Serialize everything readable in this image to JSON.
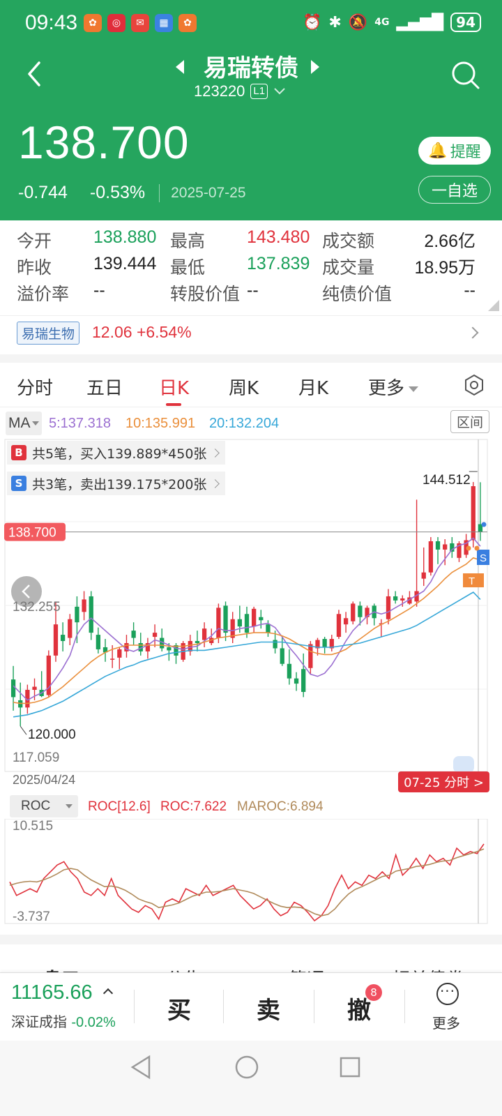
{
  "status_bar": {
    "time": "09:43",
    "network": "4G",
    "battery": "94"
  },
  "header": {
    "title": "易瑞转债",
    "code": "123220",
    "level_badge": "L1",
    "price": "138.700",
    "change": "-0.744",
    "change_pct": "-0.53%",
    "date": "2025-07-25",
    "remind_label": "提醒",
    "watchlist_label": "一自选"
  },
  "quote": {
    "open_label": "今开",
    "open": "138.880",
    "high_label": "最高",
    "high": "143.480",
    "amount_label": "成交额",
    "amount": "2.66亿",
    "prev_close_label": "昨收",
    "prev_close": "139.444",
    "low_label": "最低",
    "low": "137.839",
    "volume_label": "成交量",
    "volume": "18.95万",
    "premium_label": "溢价率",
    "premium": "--",
    "conversion_label": "转股价值",
    "conversion": "--",
    "bond_value_label": "纯债价值",
    "bond_value": "--"
  },
  "underlying": {
    "name": "易瑞生物",
    "price_change": "12.06 +6.54%"
  },
  "tabs": [
    "分时",
    "五日",
    "日K",
    "周K",
    "月K",
    "更多"
  ],
  "active_tab": "日K",
  "ma": {
    "selector": "MA",
    "ma5": "5:137.318",
    "ma10": "10:135.991",
    "ma20": "20:132.204",
    "range_label": "区间",
    "colors": {
      "ma5": "#9b6fd1",
      "ma10": "#ea8f3b",
      "ma20": "#36a7d8"
    }
  },
  "trades": {
    "buy_badge": "B",
    "buy_text": "共5笔，买入139.889*450张",
    "sell_badge": "S",
    "sell_text": "共3笔，卖出139.175*200张"
  },
  "kline_labels": {
    "current_price": "138.700",
    "max_label": "144.512",
    "min_label": "120.000",
    "axis_mid": "132.255",
    "axis_low": "117.059",
    "start_date": "2025/04/24",
    "intraday_link": "07-25 分时 >",
    "t_marker": "T",
    "s_marker": "S"
  },
  "roc": {
    "selector": "ROC",
    "params": "ROC[12.6]",
    "roc_value": "ROC:7.622",
    "maroc_value": "MAROC:6.894",
    "axis_high": "10.515",
    "axis_low": "-3.737",
    "colors": {
      "roc": "#e0323c",
      "maroc": "#b08a5a"
    }
  },
  "bottom_tabs": [
    "盘口",
    "公告",
    "简况",
    "相关债券"
  ],
  "action_bar": {
    "index_value": "11165.66",
    "index_name": "深证成指",
    "index_change": "-0.02%",
    "buy": "买",
    "sell": "卖",
    "cancel": "撤",
    "cancel_badge": "8",
    "more": "更多"
  },
  "theme": {
    "header_bg": "#25a55e",
    "up": "#e0323c",
    "down": "#1aa05a"
  },
  "chart_data": [
    {
      "type": "candlestick",
      "title": "日K",
      "x_start": "2025/04/24",
      "x_end": "2025-07-25",
      "ylim": [
        117.059,
        144.512
      ],
      "candles": [
        [
          124.5,
          125.8,
          121.5,
          122.8
        ],
        [
          122.5,
          124.2,
          120.0,
          121.8
        ],
        [
          121.8,
          124.0,
          121.2,
          123.5
        ],
        [
          123.5,
          124.6,
          122.5,
          123.8
        ],
        [
          123.5,
          125.3,
          122.8,
          122.9
        ],
        [
          123.0,
          127.3,
          122.8,
          126.8
        ],
        [
          126.8,
          132.0,
          126.2,
          129.8
        ],
        [
          128.8,
          130.0,
          127.2,
          128.2
        ],
        [
          128.5,
          130.8,
          127.8,
          130.3
        ],
        [
          131.5,
          132.5,
          128.0,
          130.0
        ],
        [
          131.0,
          133.0,
          130.2,
          132.2
        ],
        [
          132.5,
          133.0,
          128.3,
          129.0
        ],
        [
          128.8,
          129.5,
          127.0,
          127.4
        ],
        [
          127.6,
          128.4,
          126.2,
          127.1
        ],
        [
          126.4,
          127.8,
          125.6,
          126.5
        ],
        [
          126.6,
          127.6,
          125.5,
          127.4
        ],
        [
          127.2,
          128.8,
          126.6,
          128.0
        ],
        [
          129.2,
          130.0,
          127.8,
          128.5
        ],
        [
          128.0,
          129.0,
          126.8,
          127.2
        ],
        [
          127.2,
          128.5,
          126.5,
          128.0
        ],
        [
          128.6,
          129.8,
          127.6,
          129.0
        ],
        [
          128.5,
          129.4,
          127.2,
          127.5
        ],
        [
          127.6,
          128.0,
          126.3,
          127.3
        ],
        [
          127.8,
          128.0,
          126.0,
          126.8
        ],
        [
          126.4,
          128.2,
          126.2,
          128.0
        ],
        [
          127.2,
          128.8,
          126.8,
          128.2
        ],
        [
          128.2,
          129.2,
          127.2,
          128.0
        ],
        [
          128.3,
          130.0,
          127.6,
          129.4
        ],
        [
          128.0,
          129.4,
          127.8,
          128.5
        ],
        [
          128.5,
          131.8,
          128.0,
          131.4
        ],
        [
          131.6,
          132.0,
          128.2,
          129.0
        ],
        [
          128.5,
          131.0,
          128.0,
          130.3
        ],
        [
          130.3,
          131.6,
          129.0,
          129.6
        ],
        [
          130.8,
          131.5,
          128.5,
          129.0
        ],
        [
          129.6,
          131.5,
          129.0,
          131.3
        ],
        [
          130.5,
          131.2,
          129.4,
          130.2
        ],
        [
          129.8,
          130.2,
          128.6,
          129.0
        ],
        [
          128.3,
          129.2,
          127.0,
          127.5
        ],
        [
          127.5,
          128.6,
          125.8,
          126.0
        ],
        [
          126.0,
          127.4,
          124.0,
          124.6
        ],
        [
          124.6,
          125.2,
          123.4,
          124.1
        ],
        [
          125.5,
          127.0,
          122.8,
          123.3
        ],
        [
          125.6,
          128.2,
          125.0,
          127.9
        ],
        [
          127.5,
          128.5,
          126.8,
          128.3
        ],
        [
          128.4,
          128.6,
          127.0,
          127.6
        ],
        [
          127.5,
          128.8,
          127.2,
          128.4
        ],
        [
          128.6,
          131.2,
          128.4,
          130.8
        ],
        [
          129.8,
          131.0,
          129.0,
          130.4
        ],
        [
          130.1,
          132.0,
          129.8,
          131.8
        ],
        [
          131.6,
          132.0,
          129.7,
          130.5
        ],
        [
          130.5,
          131.6,
          129.8,
          131.4
        ],
        [
          131.6,
          131.8,
          129.7,
          130.4
        ],
        [
          129.8,
          130.3,
          128.6,
          129.9
        ],
        [
          130.3,
          133.2,
          129.8,
          132.5
        ],
        [
          132.5,
          133.0,
          131.8,
          132.1
        ],
        [
          132.1,
          132.6,
          131.5,
          132.3
        ],
        [
          131.8,
          133.0,
          131.7,
          132.4
        ],
        [
          132.0,
          141.8,
          131.5,
          133.0
        ],
        [
          134.2,
          137.2,
          133.5,
          134.8
        ],
        [
          134.8,
          138.2,
          134.5,
          137.8
        ],
        [
          137.8,
          138.2,
          135.6,
          137.0
        ],
        [
          137.0,
          138.0,
          135.5,
          137.5
        ],
        [
          137.6,
          138.2,
          136.2,
          136.8
        ],
        [
          136.2,
          137.8,
          135.8,
          137.6
        ],
        [
          136.5,
          138.5,
          136.2,
          137.9
        ],
        [
          137.9,
          143.5,
          137.2,
          143.1
        ],
        [
          139.444,
          143.48,
          137.839,
          138.7
        ]
      ],
      "series": [
        {
          "name": "5",
          "values": [
            123.9,
            123.2,
            122.5,
            122.9,
            123.2,
            123.7,
            124.6,
            125.6,
            126.8,
            128.8,
            129.8,
            130.4,
            129.8,
            129.2,
            128.6,
            128.0,
            127.4,
            127.2,
            127.5,
            127.8,
            128.3,
            128.1,
            127.8,
            127.5,
            127.4,
            127.6,
            127.7,
            128.2,
            128.7,
            129.4,
            129.2,
            129.2,
            129.4,
            129.5,
            129.6,
            129.8,
            129.9,
            129.5,
            128.6,
            127.6,
            126.8,
            125.9,
            125.0,
            124.8,
            125.1,
            125.9,
            127.0,
            128.2,
            129.2,
            129.9,
            130.6,
            131.0,
            130.8,
            131.0,
            131.4,
            131.8,
            132.2,
            132.6,
            133.0,
            133.9,
            135.2,
            136.1,
            137.0,
            137.4,
            137.6,
            138.1,
            137.318
          ]
        },
        {
          "name": "10",
          "values": [
            122.3,
            122.2,
            122.2,
            122.3,
            122.5,
            122.8,
            123.3,
            123.8,
            124.4,
            125.0,
            125.6,
            126.2,
            126.7,
            127.1,
            127.4,
            127.6,
            127.8,
            127.8,
            127.8,
            127.8,
            127.8,
            127.8,
            127.7,
            127.7,
            127.7,
            127.8,
            127.9,
            128.1,
            128.3,
            128.5,
            128.6,
            128.7,
            128.8,
            128.9,
            129.0,
            129.0,
            129.0,
            128.9,
            128.7,
            128.4,
            128.0,
            127.6,
            127.2,
            127.0,
            126.9,
            126.9,
            127.1,
            127.4,
            127.9,
            128.4,
            128.9,
            129.4,
            129.8,
            130.1,
            130.5,
            130.9,
            131.3,
            131.8,
            132.3,
            132.9,
            133.5,
            134.2,
            134.8,
            135.2,
            135.6,
            136.2,
            135.991
          ]
        },
        {
          "name": "20",
          "values": [
            120.9,
            121.0,
            121.1,
            121.3,
            121.5,
            121.8,
            122.1,
            122.4,
            122.8,
            123.2,
            123.6,
            124.0,
            124.4,
            124.8,
            125.1,
            125.4,
            125.7,
            125.9,
            126.2,
            126.4,
            126.6,
            126.8,
            127.0,
            127.1,
            127.2,
            127.3,
            127.3,
            127.3,
            127.4,
            127.5,
            127.6,
            127.7,
            127.8,
            127.9,
            128.0,
            128.1,
            128.1,
            128.1,
            128.1,
            128.0,
            127.9,
            127.8,
            127.7,
            127.6,
            127.6,
            127.6,
            127.7,
            127.8,
            127.9,
            128.0,
            128.2,
            128.4,
            128.6,
            128.8,
            129.0,
            129.2,
            129.4,
            129.7,
            130.1,
            130.5,
            130.9,
            131.3,
            131.7,
            132.1,
            132.5,
            132.9,
            132.204
          ]
        }
      ]
    },
    {
      "type": "line",
      "title": "ROC",
      "ylim": [
        -3.737,
        10.515
      ],
      "series": [
        {
          "name": "ROC",
          "values": [
            2.0,
            0.0,
            0.5,
            1.0,
            0.5,
            2.5,
            3.5,
            4.5,
            5.0,
            3.5,
            2.5,
            0.5,
            0.0,
            1.0,
            0.0,
            2.5,
            0.0,
            -1.0,
            -2.0,
            -2.5,
            -1.5,
            -2.0,
            -3.5,
            -1.0,
            -0.5,
            -1.0,
            1.0,
            0.5,
            0.0,
            1.5,
            0.0,
            0.5,
            1.0,
            1.5,
            0.0,
            -1.0,
            -2.0,
            -1.5,
            -0.5,
            -2.0,
            -3.0,
            -2.5,
            -1.0,
            -1.5,
            -2.5,
            -3.737,
            -3.0,
            -1.5,
            1.0,
            3.0,
            1.0,
            2.0,
            1.5,
            3.0,
            2.5,
            3.5,
            2.5,
            6.0,
            3.0,
            4.0,
            5.5,
            4.0,
            6.0,
            5.0,
            5.5,
            4.5,
            7.0,
            6.0,
            6.5,
            6.2,
            7.622
          ]
        },
        {
          "name": "MAROC",
          "values": [
            1.5,
            1.8,
            2.0,
            2.1,
            2.0,
            2.3,
            2.7,
            3.2,
            3.8,
            4.0,
            3.8,
            3.0,
            2.3,
            1.8,
            1.3,
            1.4,
            1.2,
            0.8,
            0.2,
            -0.5,
            -0.9,
            -1.2,
            -1.8,
            -1.6,
            -1.4,
            -1.1,
            -0.6,
            -0.1,
            0.2,
            0.5,
            0.5,
            0.6,
            0.8,
            1.0,
            0.8,
            0.6,
            0.3,
            -0.2,
            -0.7,
            -1.2,
            -1.6,
            -1.8,
            -1.7,
            -1.8,
            -2.2,
            -2.7,
            -3.0,
            -2.8,
            -2.0,
            -0.8,
            0.2,
            0.9,
            1.3,
            1.8,
            2.3,
            2.8,
            3.0,
            3.6,
            3.8,
            4.0,
            4.3,
            4.4,
            4.6,
            4.9,
            5.1,
            5.2,
            5.6,
            5.9,
            6.2,
            6.5,
            6.894
          ]
        }
      ]
    }
  ]
}
